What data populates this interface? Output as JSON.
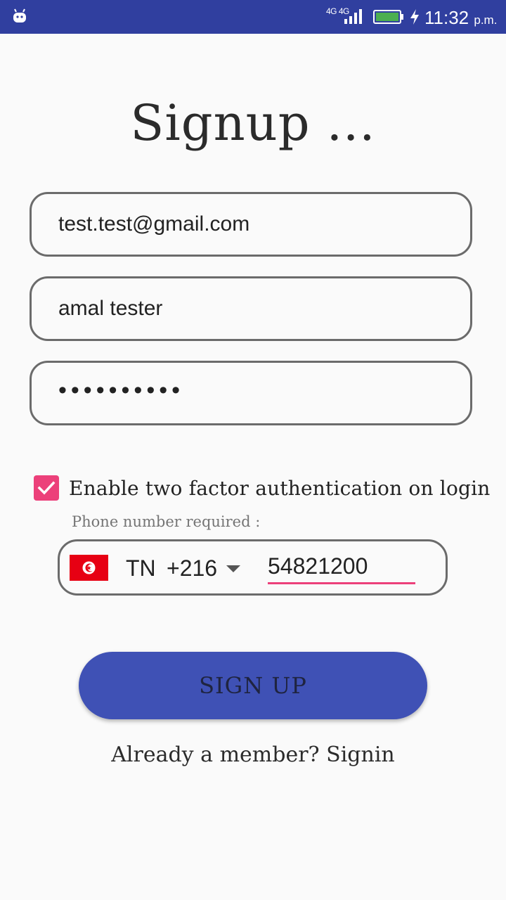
{
  "status_bar": {
    "network": "4G 4G",
    "sim_slot": "2",
    "time": "11:32",
    "ampm": "p.m.",
    "battery_level": 1.0,
    "charging": true
  },
  "page": {
    "title": "Signup ..."
  },
  "form": {
    "email_value": "test.test@gmail.com",
    "name_value": "amal tester",
    "password_value": "••••••••••"
  },
  "two_factor": {
    "checked": true,
    "label": "Enable two factor authentication on login",
    "phone_hint": "Phone number required :"
  },
  "phone": {
    "country_code": "TN",
    "dial_code": "+216",
    "number": "54821200"
  },
  "actions": {
    "signup_label": "SIGN UP",
    "signin_link": "Already a member? Signin"
  },
  "colors": {
    "status_bar": "#303f9f",
    "primary_button": "#3f51b5",
    "accent": "#ec407a",
    "flag_red": "#e70013"
  }
}
